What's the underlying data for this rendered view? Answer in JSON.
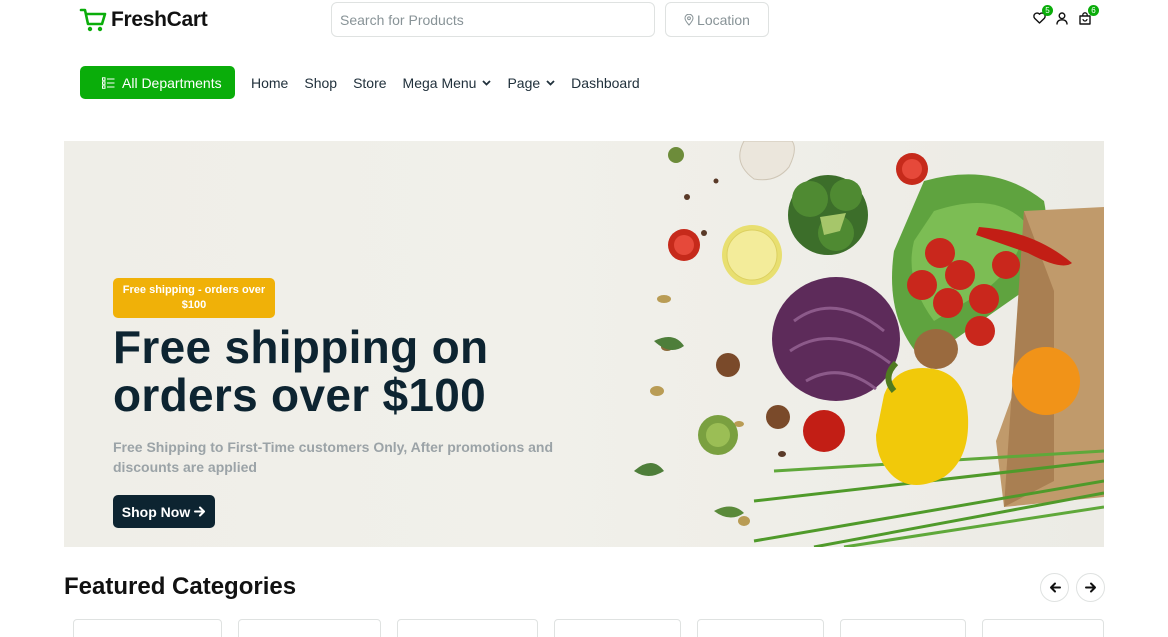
{
  "brand": {
    "name": "FreshCart",
    "color": "#0aad0a"
  },
  "search": {
    "placeholder": "Search for Products"
  },
  "location": {
    "label": "Location"
  },
  "header_icons": [
    {
      "icon": "heart-icon",
      "badge": "5"
    },
    {
      "icon": "user-icon",
      "badge": ""
    },
    {
      "icon": "shopping-bag-icon",
      "badge": "6"
    }
  ],
  "nav": {
    "departments_label": "All Departments",
    "items": [
      {
        "label": "Home",
        "dropdown": false
      },
      {
        "label": "Shop",
        "dropdown": false
      },
      {
        "label": "Store",
        "dropdown": false
      },
      {
        "label": "Mega Menu",
        "dropdown": true
      },
      {
        "label": "Page",
        "dropdown": true
      },
      {
        "label": "Dashboard",
        "dropdown": false
      }
    ]
  },
  "hero": {
    "badge": "Free shipping - orders over $100",
    "title": "Free shipping on orders over $100",
    "description": "Free Shipping to First-Time customers Only, After promotions and discounts are applied",
    "cta_label": "Shop Now",
    "badge_color": "#f0b108",
    "cta_color": "#0d2431"
  },
  "featured": {
    "title": "Featured Categories",
    "prev_icon": "arrow-left-icon",
    "next_icon": "arrow-right-icon",
    "card_count": 7
  }
}
